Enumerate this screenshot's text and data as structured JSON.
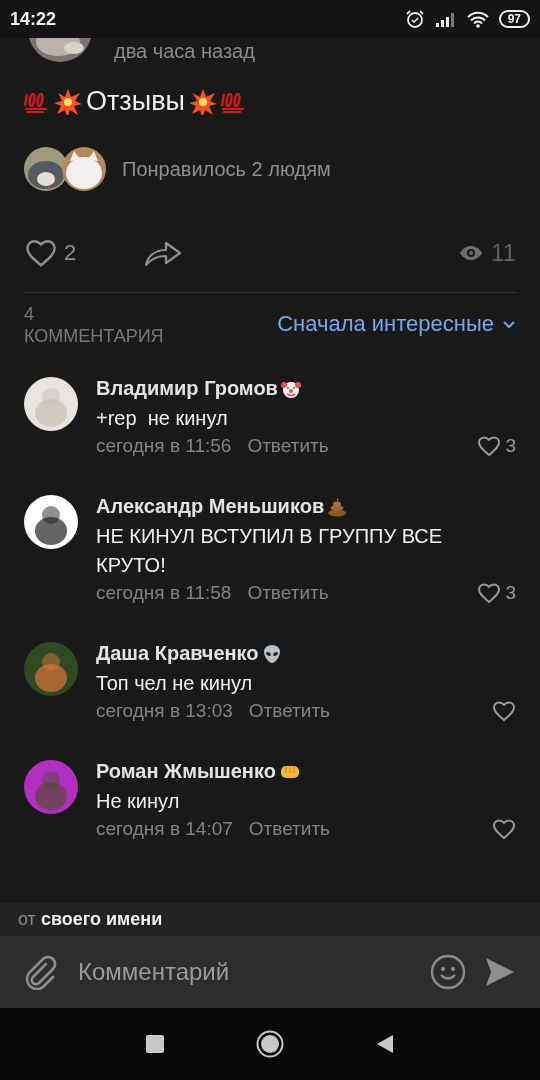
{
  "status_bar": {
    "time": "14:22",
    "battery": "97"
  },
  "post": {
    "time": "два часа назад",
    "title": "Отзывы",
    "liked_by": "Понравилось 2 людям",
    "likes": "2",
    "liked": false,
    "views": "11"
  },
  "comments_header": {
    "count": "4",
    "label": "КОММЕНТАРИЯ",
    "sort": "Сначала интересные"
  },
  "comments": [
    {
      "author": "Владимир Громов",
      "text": "+rep  не кинул",
      "time": "сегодня в 11:56",
      "reply": "Ответить",
      "likes": "3",
      "liked": false
    },
    {
      "author": "Александр Меньшиков",
      "text": "НЕ КИНУЛ ВСТУПИЛ В ГРУППУ ВСЕ КРУТО!",
      "time": "сегодня в 11:58",
      "reply": "Ответить",
      "likes": "3",
      "liked": false
    },
    {
      "author": "Даша Кравченко",
      "text": "Топ чел не кинул",
      "time": "сегодня в 13:03",
      "reply": "Ответить",
      "liked": false
    },
    {
      "author": "Роман Жмышенко",
      "text": "Не кинул",
      "time": "сегодня в 14:07",
      "reply": "Ответить",
      "liked": false
    }
  ],
  "composer": {
    "identity": "от **своего имени**",
    "placeholder": "Комментарий"
  }
}
